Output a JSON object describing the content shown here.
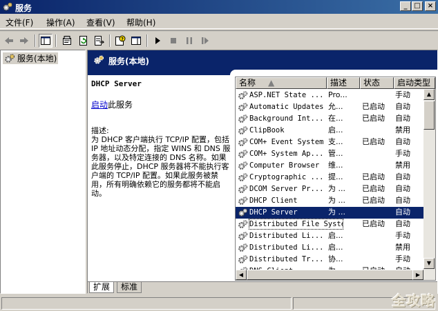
{
  "window": {
    "title": "服务",
    "minimize": "_",
    "maximize": "□",
    "close": "×"
  },
  "menu": [
    "文件(F)",
    "操作(A)",
    "查看(V)",
    "帮助(H)"
  ],
  "tree": {
    "root": "服务(本地)"
  },
  "banner": {
    "title": "服务(本地)"
  },
  "details": {
    "service_name": "DHCP Server",
    "start_link": "启动",
    "start_suffix": "此服务",
    "desc_label": "描述:",
    "desc_text": "为 DHCP 客户端执行 TCP/IP 配置，包括 IP 地址动态分配，指定 WINS 和 DNS 服务器，以及特定连接的 DNS 名称。如果此服务停止，DHCP 服务器将不能执行客户端的 TCP/IP 配置。如果此服务被禁用，所有明确依赖它的服务都将不能启动。"
  },
  "list": {
    "columns": [
      "名称",
      "描述",
      "状态",
      "启动类型"
    ],
    "rows": [
      {
        "name": "ASP.NET State ...",
        "desc": "Pro...",
        "status": "",
        "start": "手动"
      },
      {
        "name": "Automatic Updates",
        "desc": "允...",
        "status": "已启动",
        "start": "自动"
      },
      {
        "name": "Background Int...",
        "desc": "在...",
        "status": "已启动",
        "start": "自动"
      },
      {
        "name": "ClipBook",
        "desc": "启...",
        "status": "",
        "start": "禁用"
      },
      {
        "name": "COM+ Event System",
        "desc": "支...",
        "status": "已启动",
        "start": "自动"
      },
      {
        "name": "COM+ System Ap...",
        "desc": "管...",
        "status": "",
        "start": "手动"
      },
      {
        "name": "Computer Browser",
        "desc": "维...",
        "status": "",
        "start": "禁用"
      },
      {
        "name": "Cryptographic ...",
        "desc": "提...",
        "status": "已启动",
        "start": "自动"
      },
      {
        "name": "DCOM Server Pr...",
        "desc": "为 ...",
        "status": "已启动",
        "start": "自动"
      },
      {
        "name": "DHCP Client",
        "desc": "为 ...",
        "status": "已启动",
        "start": "自动"
      },
      {
        "name": "DHCP Server",
        "desc": "为 ...",
        "status": "",
        "start": "自动"
      },
      {
        "name": "Distributed File System",
        "desc": "",
        "status": "已启动",
        "start": "自动"
      },
      {
        "name": "Distributed Li...",
        "desc": "启...",
        "status": "",
        "start": "手动"
      },
      {
        "name": "Distributed Li...",
        "desc": "启...",
        "status": "",
        "start": "禁用"
      },
      {
        "name": "Distributed Tr...",
        "desc": "协...",
        "status": "",
        "start": "手动"
      },
      {
        "name": "DNS Client",
        "desc": "为 ...",
        "status": "已启动",
        "start": "自动"
      }
    ],
    "selected_index": 10,
    "focus_index": 11
  },
  "tabs": [
    "扩展",
    "标准"
  ],
  "watermark": "全攻略"
}
